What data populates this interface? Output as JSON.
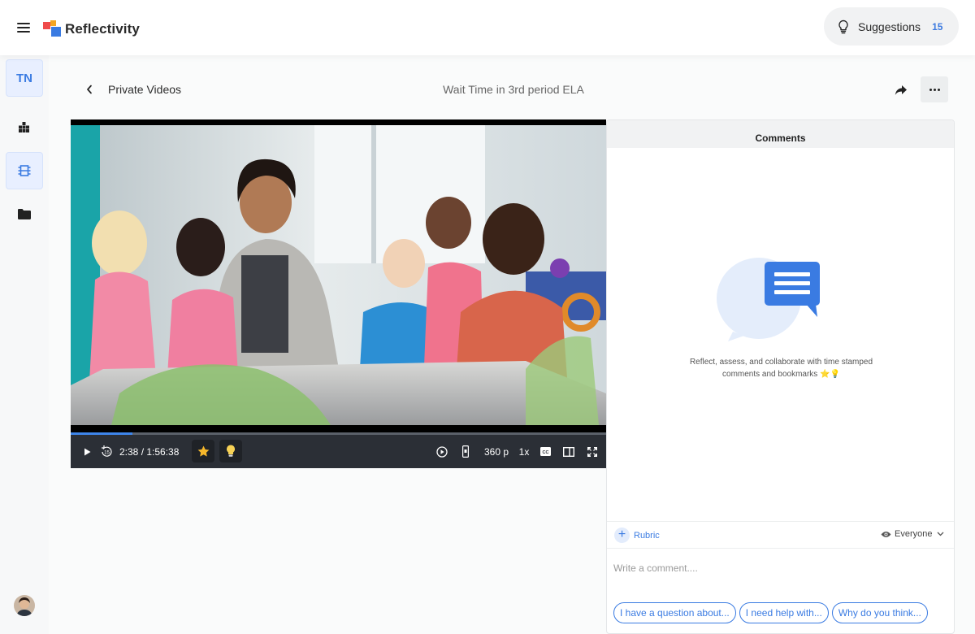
{
  "app": {
    "name": "Reflectivity",
    "menu_icon": "hamburger-menu-icon",
    "brand_colors": [
      "#ef4b4b",
      "#f5a623",
      "#3a7be2"
    ]
  },
  "header": {
    "suggestions_label": "Suggestions",
    "suggestions_count": "15",
    "suggestions_icon": "lightbulb-icon"
  },
  "sidebar": {
    "user_initials": "TN",
    "items": [
      {
        "name": "analytics",
        "icon": "bar-chart-icon",
        "active": false
      },
      {
        "name": "videos",
        "icon": "film-icon",
        "active": true
      },
      {
        "name": "folders",
        "icon": "folder-icon",
        "active": false
      }
    ],
    "avatar_icon": "user-avatar-icon"
  },
  "page": {
    "breadcrumb": "Private Videos",
    "title": "Wait Time in 3rd period ELA",
    "share_icon": "share-arrow-icon",
    "more_icon": "more-dots-icon"
  },
  "player": {
    "time": "2:38 / 1:56:38",
    "progress": 0.115,
    "quality": "360 p",
    "speed": "1x",
    "accent": "#3e85ea",
    "rewind_label": "15",
    "bookmark_star_icon": "star-icon",
    "bookmark_bulb_icon": "lightbulb-icon"
  },
  "comments": {
    "header": "Comments",
    "empty_line1": "Reflect, assess, and collaborate with time stamped",
    "empty_line2": "comments and bookmarks",
    "empty_emoji": "⭐💡",
    "rubric_label": "Rubric",
    "visibility": "Everyone",
    "input_placeholder": "Write a comment....",
    "chips": [
      "I have a question about...",
      "I need help with...",
      "Why do you think..."
    ]
  }
}
